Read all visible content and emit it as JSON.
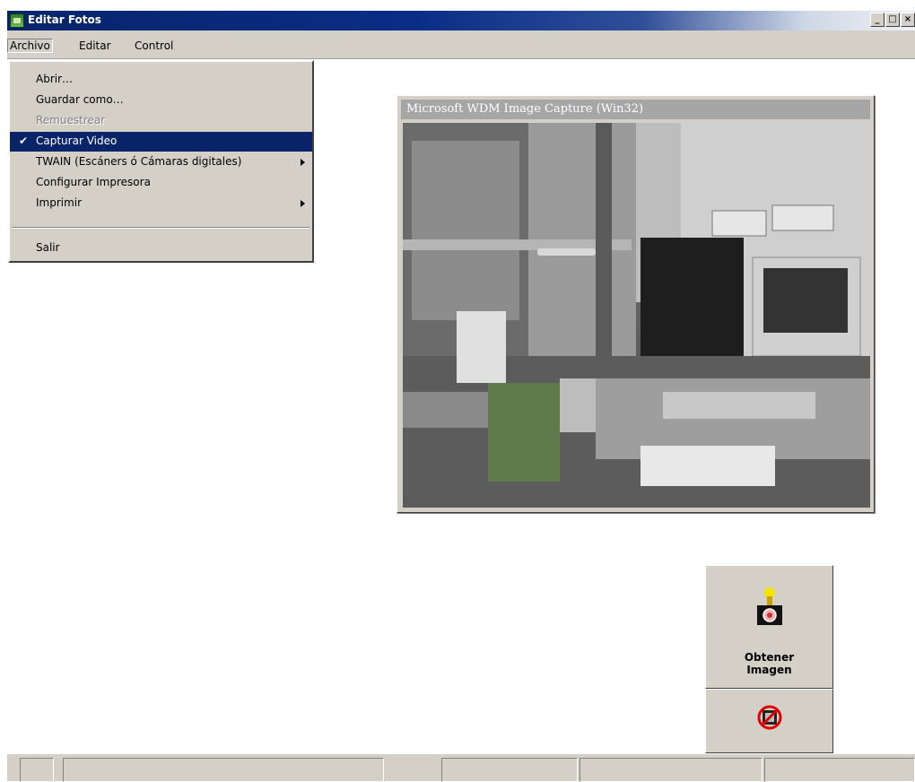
{
  "window": {
    "title": "Editar Fotos",
    "buttons": [
      "_",
      "□",
      "×"
    ]
  },
  "menubar": {
    "items": [
      "Archivo",
      "Editar",
      "Control"
    ]
  },
  "archivo_menu": {
    "items": [
      {
        "label": "Abrir…",
        "state": "normal"
      },
      {
        "label": "Guardar como…",
        "state": "normal"
      },
      {
        "label": "Remuestrear",
        "state": "disabled"
      },
      {
        "label": "Capturar Video",
        "state": "checked-selected",
        "check": "✔"
      },
      {
        "label": "TWAIN (Escáners ó Cámaras digitales)",
        "state": "submenu"
      },
      {
        "label": "Configurar Impresora",
        "state": "normal"
      },
      {
        "label": "Imprimir",
        "state": "submenu"
      },
      {
        "label": "Salir",
        "state": "normal"
      }
    ]
  },
  "capture_window": {
    "title": "Microsoft WDM Image Capture (Win32)"
  },
  "buttons": {
    "obtener_imagen": {
      "line1": "Obtener",
      "line2": "Imagen",
      "icon": "camera-icon"
    },
    "stop_video": {
      "icon": "no-video-icon"
    }
  },
  "colors": {
    "titlebar": "#0a246a",
    "face": "#d4d0c8",
    "highlight": "#0a246a"
  }
}
